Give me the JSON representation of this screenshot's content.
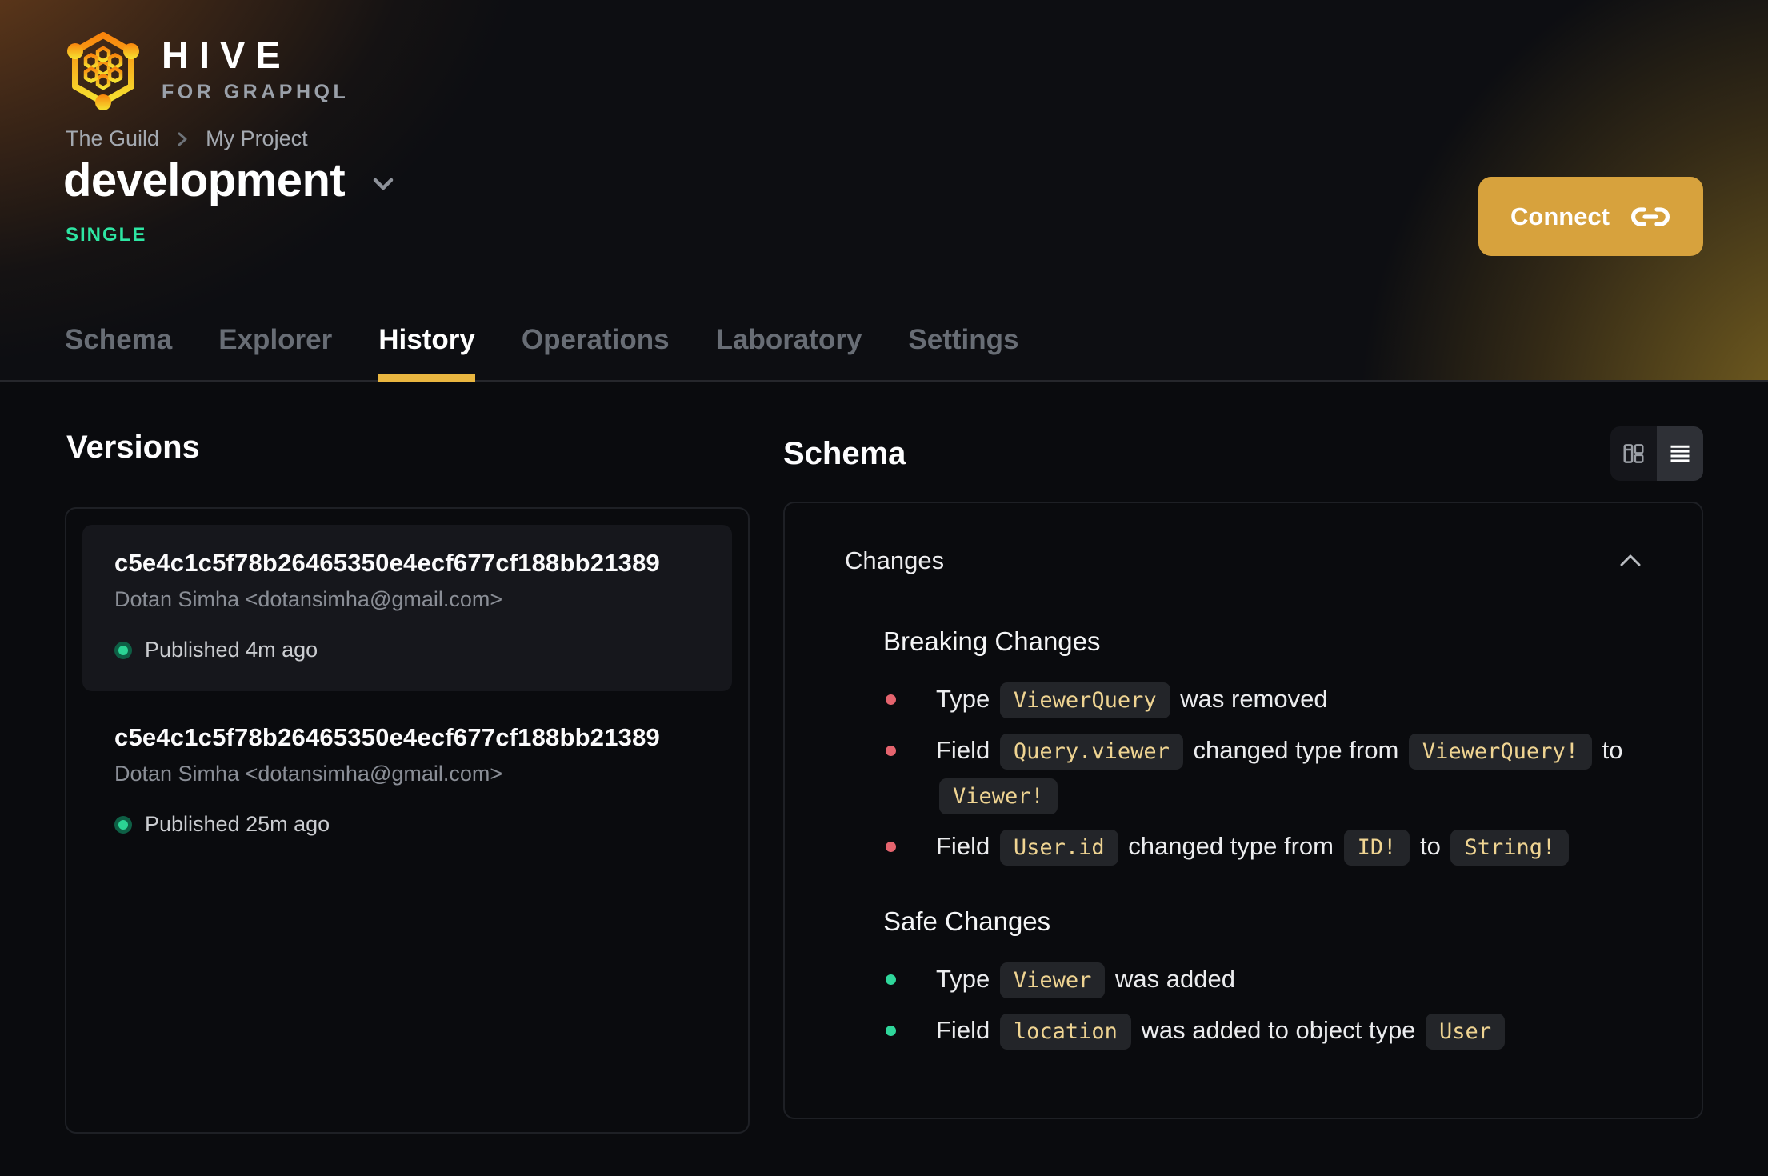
{
  "brand": {
    "name": "HIVE",
    "tagline": "FOR GRAPHQL"
  },
  "breadcrumb": {
    "items": [
      "The Guild",
      "My Project"
    ]
  },
  "target": {
    "name": "development",
    "badge": "SINGLE"
  },
  "header_actions": {
    "connect_label": "Connect"
  },
  "tabs": {
    "items": [
      {
        "label": "Schema",
        "active": false
      },
      {
        "label": "Explorer",
        "active": false
      },
      {
        "label": "History",
        "active": true
      },
      {
        "label": "Operations",
        "active": false
      },
      {
        "label": "Laboratory",
        "active": false
      },
      {
        "label": "Settings",
        "active": false
      }
    ]
  },
  "versions": {
    "heading": "Versions",
    "items": [
      {
        "hash": "c5e4c1c5f78b26465350e4ecf677cf188bb21389",
        "author": "Dotan Simha <dotansimha@gmail.com>",
        "status": "Published 4m ago",
        "selected": true
      },
      {
        "hash": "c5e4c1c5f78b26465350e4ecf677cf188bb21389",
        "author": "Dotan Simha <dotansimha@gmail.com>",
        "status": "Published 25m ago",
        "selected": false
      }
    ]
  },
  "schema": {
    "heading": "Schema",
    "view_toggle": {
      "options": [
        "side-by-side-view",
        "list-view"
      ],
      "active": "list-view"
    },
    "changes": {
      "header": "Changes",
      "sections": [
        {
          "title": "Breaking Changes",
          "bullet_color": "#e5646e",
          "items": [
            [
              {
                "text": "Type "
              },
              {
                "code": "ViewerQuery"
              },
              {
                "text": " was removed"
              }
            ],
            [
              {
                "text": "Field "
              },
              {
                "code": "Query.viewer"
              },
              {
                "text": " changed type from "
              },
              {
                "code": "ViewerQuery!"
              },
              {
                "text": " to "
              },
              {
                "code": "Viewer!"
              }
            ],
            [
              {
                "text": "Field "
              },
              {
                "code": "User.id"
              },
              {
                "text": " changed type from "
              },
              {
                "code": "ID!"
              },
              {
                "text": " to "
              },
              {
                "code": "String!"
              }
            ]
          ]
        },
        {
          "title": "Safe Changes",
          "bullet_color": "#2fd79b",
          "items": [
            [
              {
                "text": "Type "
              },
              {
                "code": "Viewer"
              },
              {
                "text": " was added"
              }
            ],
            [
              {
                "text": "Field "
              },
              {
                "code": "location"
              },
              {
                "text": " was added to object type "
              },
              {
                "code": "User"
              }
            ]
          ]
        }
      ]
    }
  },
  "status": {
    "published_dot_color": "#2bd394"
  },
  "colors": {
    "accent_amber": "#d7a23d",
    "tab_underline": "#e9b640",
    "single_badge": "#2ee6a3",
    "breaking_bullet": "#e5646e",
    "safe_bullet": "#2fd79b",
    "code_text": "#efd492",
    "chip_bg": "#232529"
  },
  "icons": {
    "logo": "hive-hexagon-logo",
    "connect": "link-icon",
    "target_dropdown": "chevron-down-icon",
    "breadcrumb_separator": "chevron-right-icon",
    "view_columns": "columns-view-icon",
    "view_list": "list-view-icon",
    "changes_collapse": "chevron-up-icon",
    "published": "status-dot-icon"
  }
}
